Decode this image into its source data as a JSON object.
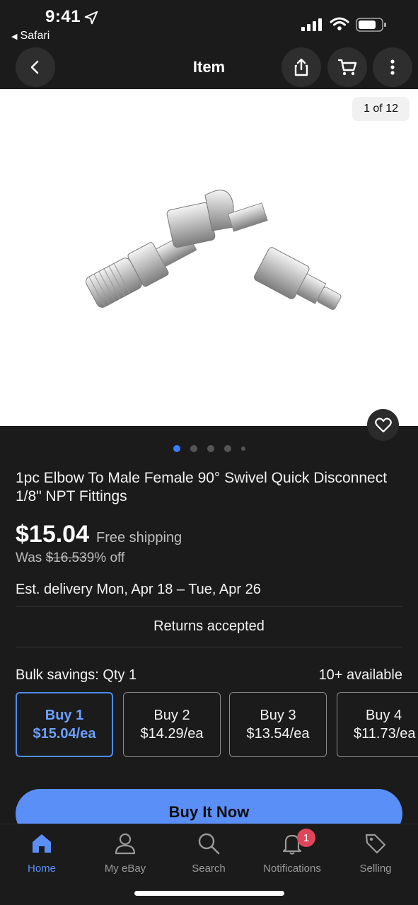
{
  "status": {
    "time": "9:41",
    "back_app": "Safari"
  },
  "nav": {
    "title": "Item"
  },
  "gallery": {
    "counter": "1 of 12"
  },
  "product": {
    "title": "1pc Elbow To Male Female 90° Swivel Quick Disconnect  1/8\" NPT Fittings",
    "price": "$15.04",
    "shipping": "Free shipping",
    "was_label": "Was",
    "was_price": "$16.53",
    "discount": "9% off",
    "delivery": "Est. delivery Mon, Apr 18 – Tue, Apr 26",
    "returns": "Returns accepted",
    "bulk_label": "Bulk savings: Qty 1",
    "available": "10+ available"
  },
  "bulk_options": [
    {
      "line1": "Buy 1",
      "line2": "$15.04/ea"
    },
    {
      "line1": "Buy 2",
      "line2": "$14.29/ea"
    },
    {
      "line1": "Buy 3",
      "line2": "$13.54/ea"
    },
    {
      "line1": "Buy 4",
      "line2": "$11.73/ea"
    }
  ],
  "cta": {
    "buy_now": "Buy It Now"
  },
  "tabs": [
    {
      "label": "Home",
      "icon": "home-icon"
    },
    {
      "label": "My eBay",
      "icon": "person-icon"
    },
    {
      "label": "Search",
      "icon": "search-icon"
    },
    {
      "label": "Notifications",
      "icon": "bell-icon",
      "badge": "1"
    },
    {
      "label": "Selling",
      "icon": "tag-icon"
    }
  ],
  "colors": {
    "accent": "#5a8ff8",
    "background": "#1b1b1b",
    "badge": "#e0465a"
  }
}
